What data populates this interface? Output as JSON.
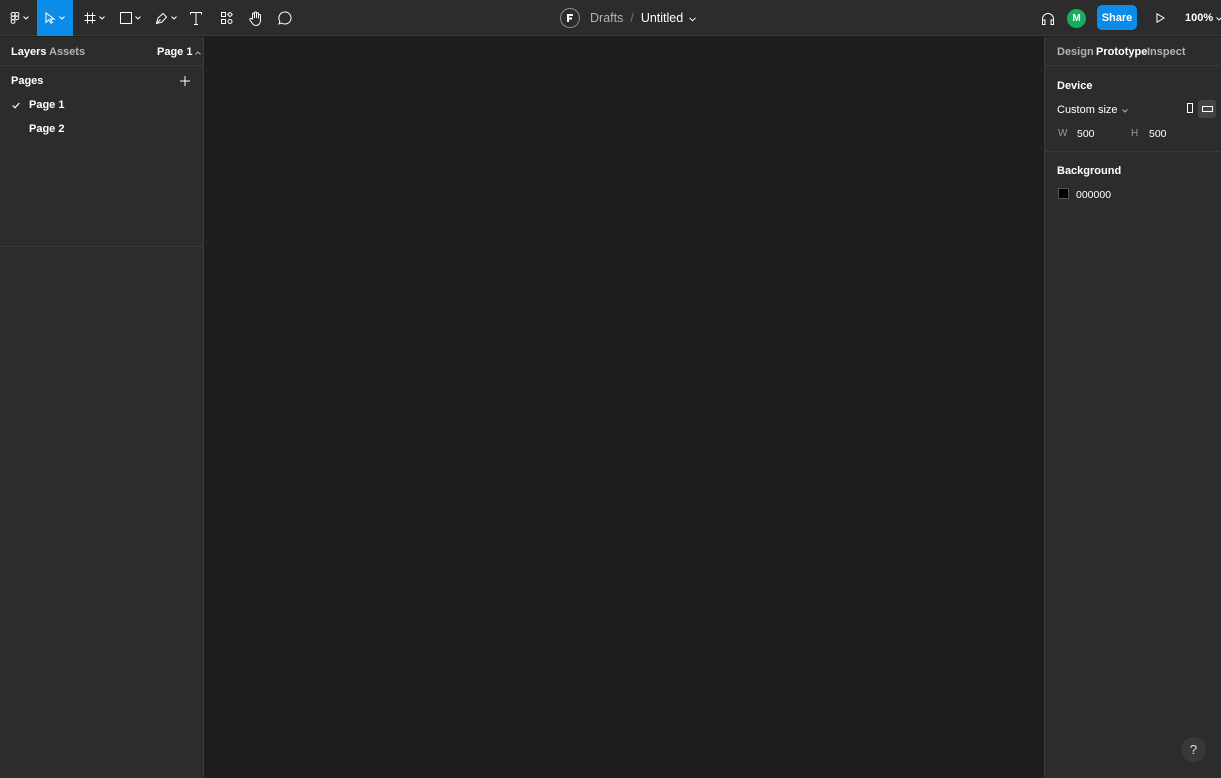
{
  "toolbar": {
    "tools": [
      {
        "name": "main-menu",
        "icon": "figma-logo-icon"
      },
      {
        "name": "move",
        "icon": "cursor-icon",
        "active": true
      },
      {
        "name": "frame",
        "icon": "frame-icon"
      },
      {
        "name": "shape",
        "icon": "rectangle-icon"
      },
      {
        "name": "pen",
        "icon": "pen-icon"
      },
      {
        "name": "text",
        "icon": "text-icon"
      },
      {
        "name": "resources",
        "icon": "resources-icon"
      },
      {
        "name": "hand",
        "icon": "hand-icon"
      },
      {
        "name": "comment",
        "icon": "comment-icon"
      }
    ],
    "breadcrumb_folder": "Drafts",
    "breadcrumb_separator": "/",
    "file_name": "Untitled",
    "avatar_initial": "M",
    "share_label": "Share",
    "zoom_label": "100%"
  },
  "left_panel": {
    "tabs": [
      "Layers",
      "Assets"
    ],
    "current_page": "Page 1",
    "pages_header": "Pages",
    "pages": [
      {
        "label": "Page 1",
        "selected": true
      },
      {
        "label": "Page 2",
        "selected": false
      }
    ]
  },
  "right_panel": {
    "tabs": [
      "Design",
      "Prototype",
      "Inspect"
    ],
    "active_tab": "Prototype",
    "device_title": "Device",
    "device_value": "Custom size",
    "width_label": "W",
    "width_value": "500",
    "height_label": "H",
    "height_value": "500",
    "background_title": "Background",
    "background_hex": "000000"
  },
  "help_label": "?",
  "colors": {
    "accent": "#0c8ce9",
    "avatar": "#14ae5c",
    "panel": "#2c2c2c",
    "canvas": "#1e1e1e"
  }
}
